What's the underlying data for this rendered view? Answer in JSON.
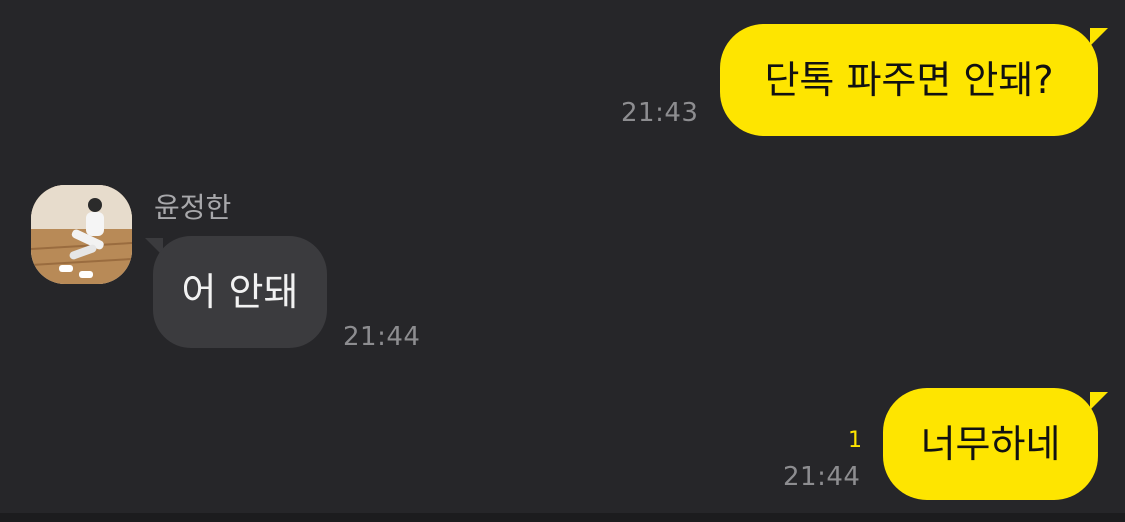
{
  "messages": [
    {
      "sender": "me",
      "text": "단톡 파주면 안돼?",
      "time": "21:43"
    },
    {
      "sender": "other",
      "name": "윤정한",
      "text": "어 안돼",
      "time": "21:44"
    },
    {
      "sender": "me",
      "text": "너무하네",
      "time": "21:44",
      "unread": "1"
    }
  ],
  "colors": {
    "background": "#262629",
    "my_bubble": "#FEE500",
    "other_bubble": "#3B3B3E",
    "timestamp": "#8D8D90",
    "unread_count": "#FEE500"
  },
  "icons": {
    "avatar": "profile-photo"
  }
}
